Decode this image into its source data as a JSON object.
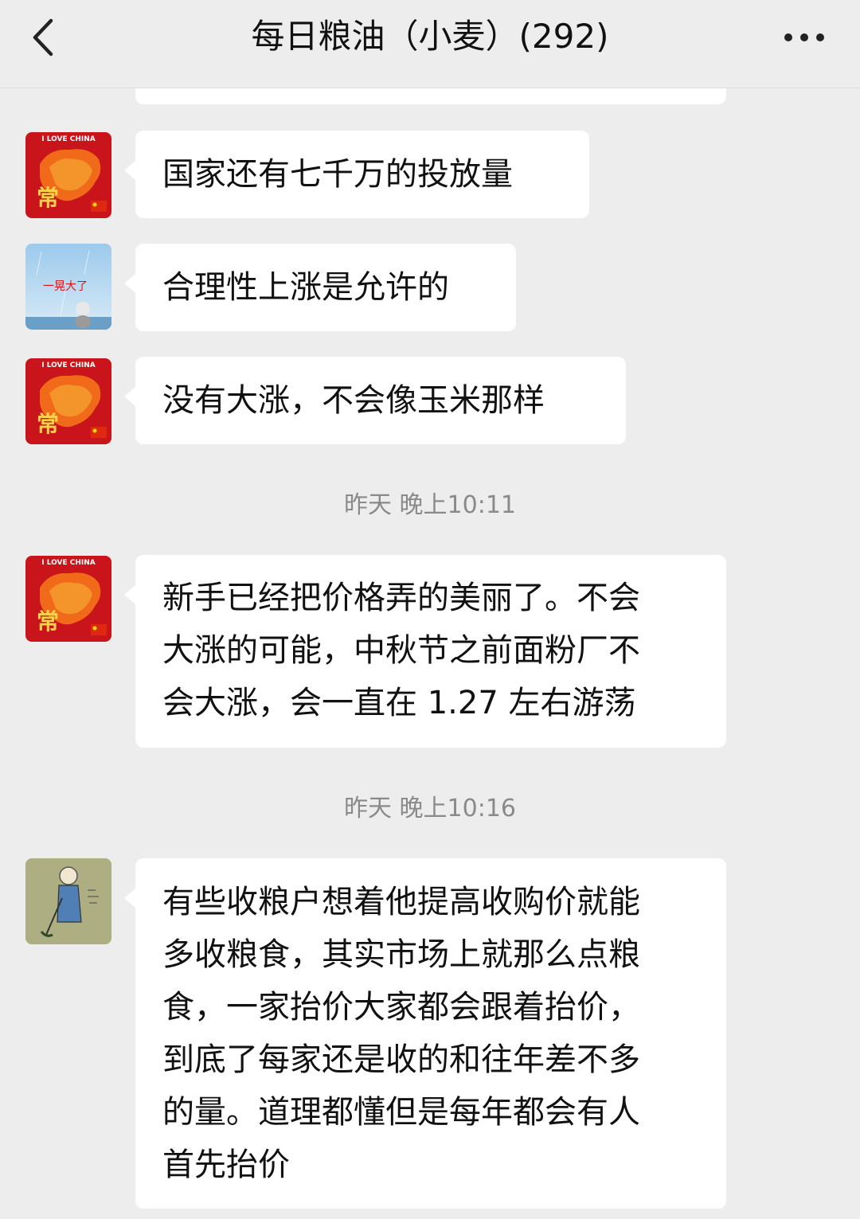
{
  "header": {
    "title": "每日粮油（小麦）(292)"
  },
  "avatars": {
    "china": {
      "top_text": "I LOVE CHINA",
      "glyph": "常"
    },
    "rain": {
      "caption": "一晃大了"
    }
  },
  "messages": [
    {
      "text": "国家还有七千万的投放量"
    },
    {
      "text": "合理性上涨是允许的"
    },
    {
      "text": "没有大涨，不会像玉米那样"
    },
    {
      "lines": [
        "新手已经把价格弄的美丽了。不会",
        "大涨的可能，中秋节之前面粉厂不",
        "会大涨，会一直在 1.27 左右游荡"
      ]
    },
    {
      "lines": [
        "有些收粮户想着他提高收购价就能",
        "多收粮食，其实市场上就那么点粮",
        "食，一家抬价大家都会跟着抬价，",
        "到底了每家还是收的和往年差不多",
        "的量。道理都懂但是每年都会有人",
        "首先抬价"
      ]
    }
  ],
  "timestamps": [
    "昨天 晚上10:11",
    "昨天 晚上10:16"
  ],
  "colors": {
    "background": "#ededed",
    "bubble": "#ffffff",
    "timestamp": "#8a8a8a"
  },
  "icons": [
    "back-arrow-icon",
    "more-dots-icon"
  ]
}
